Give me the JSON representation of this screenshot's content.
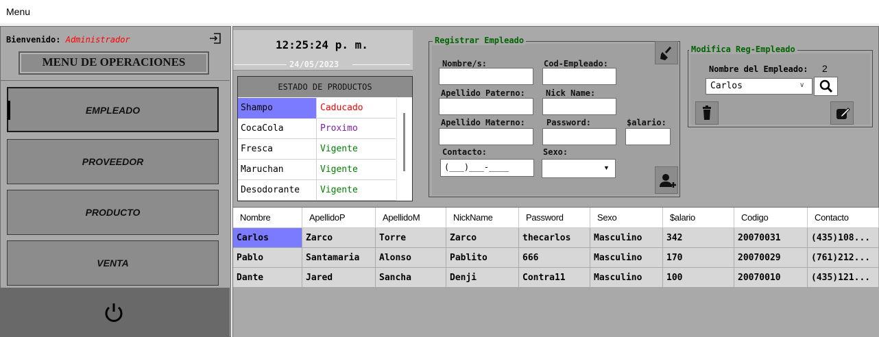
{
  "menubar": {
    "menu_label": "Menu"
  },
  "left": {
    "welcome_label": "Bienvenido:",
    "welcome_user": "Administrador",
    "title": "MENU DE OPERACIONES",
    "buttons": [
      "EMPLEADO",
      "PROVEEDOR",
      "PRODUCTO",
      "VENTA"
    ]
  },
  "clock": {
    "time": "12:25:24 p. m.",
    "date": "24/05/2023"
  },
  "estado": {
    "header": "ESTADO DE PRODUCTOS",
    "rows": [
      {
        "name": "Shampo",
        "status": "Caducado",
        "color": "#ff0000"
      },
      {
        "name": "CocaCola",
        "status": "Proximo",
        "color": "#7b1fa2"
      },
      {
        "name": "Fresca",
        "status": "Vigente",
        "color": "#008000"
      },
      {
        "name": "Maruchan",
        "status": "Vigente",
        "color": "#008000"
      },
      {
        "name": "Desodorante",
        "status": "Vigente",
        "color": "#008000"
      }
    ]
  },
  "registrar": {
    "legend": "Registrar Empleado",
    "nombre_label": "Nombre/s:",
    "cod_label": "Cod-Empleado:",
    "ap_paterno_label": "Apellido Paterno:",
    "nick_label": "Nick Name:",
    "ap_materno_label": "Apellido Materno:",
    "password_label": "Password:",
    "salario_label": "$alario:",
    "contacto_label": "Contacto:",
    "sexo_label": "Sexo:",
    "contacto_mask": "(___)___-____"
  },
  "modifica": {
    "legend": "Modifica Reg-Empleado",
    "nombre_label": "Nombre del Empleado:",
    "count": "2",
    "selected": "Carlos"
  },
  "grid": {
    "columns": [
      "Nombre",
      "ApellidoP",
      "ApellidoM",
      "NickName",
      "Password",
      "Sexo",
      "$alario",
      "Codigo",
      "Contacto"
    ],
    "rows": [
      [
        "Carlos",
        "Zarco",
        "Torre",
        "Zarco",
        "thecarlos",
        "Masculino",
        "342",
        "20070031",
        "(435)108..."
      ],
      [
        "Pablo",
        "Santamaria",
        "Alonso",
        "Pablito",
        "666",
        "Masculino",
        "170",
        "20070029",
        "(761)212..."
      ],
      [
        "Dante",
        "Jared",
        "Sancha",
        "Denji",
        "Contra11",
        "Masculino",
        "100",
        "20070010",
        "(435)121..."
      ]
    ]
  },
  "colors": {
    "accent_selection": "#7b7bff",
    "legend_green": "#006400",
    "welcome_red": "#ff0000"
  }
}
